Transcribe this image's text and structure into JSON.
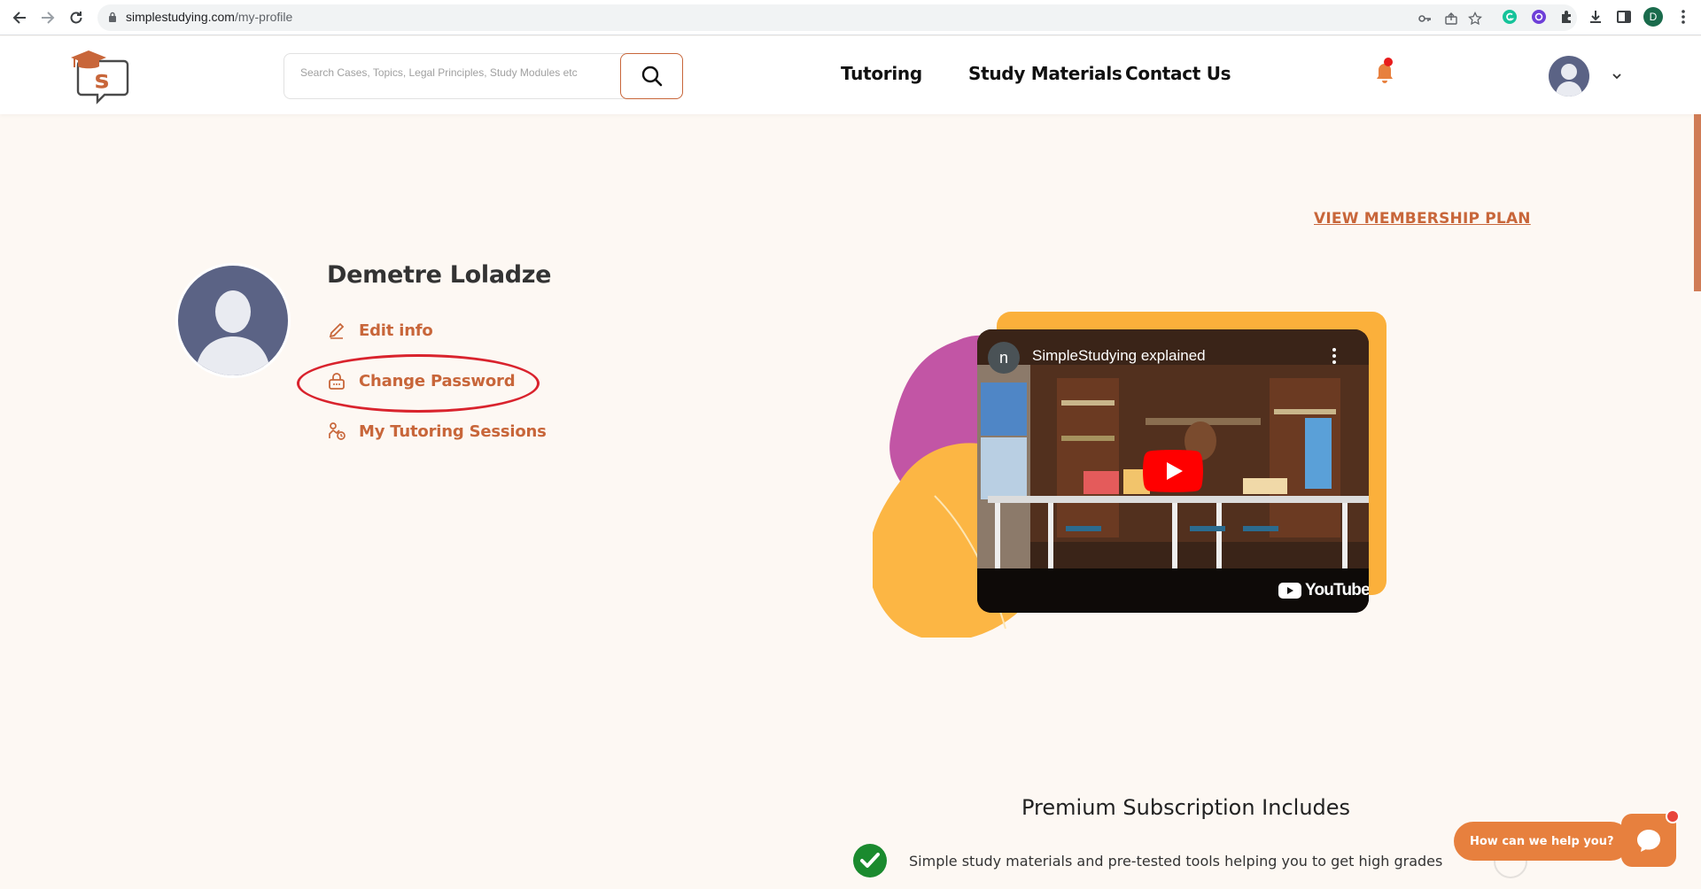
{
  "browser": {
    "url_domain": "simplestudying.com",
    "url_path": "/my-profile",
    "profile_initial": "D"
  },
  "header": {
    "search_placeholder": "Search Cases, Topics, Legal Principles, Study Modules etc",
    "nav": {
      "tutoring": "Tutoring",
      "study_materials": "Study Materials",
      "contact_us": "Contact Us"
    }
  },
  "profile": {
    "view_plan": "VIEW MEMBERSHIP PLAN",
    "name": "Demetre Loladze",
    "menu": {
      "edit_info": "Edit info",
      "change_password": "Change Password",
      "tutoring_sessions": "My Tutoring Sessions"
    }
  },
  "video": {
    "channel_initial": "n",
    "title": "SimpleStudying explained",
    "provider": "YouTube"
  },
  "subscription": {
    "title": "Premium Subscription Includes",
    "items": [
      "Simple study materials and pre-tested tools helping you to get high grades"
    ]
  },
  "chat": {
    "prompt": "How can we help you?"
  },
  "colors": {
    "accent": "#c8663a",
    "avatar": "#5b6385",
    "highlight": "#d9232d",
    "chat": "#e7803e"
  }
}
